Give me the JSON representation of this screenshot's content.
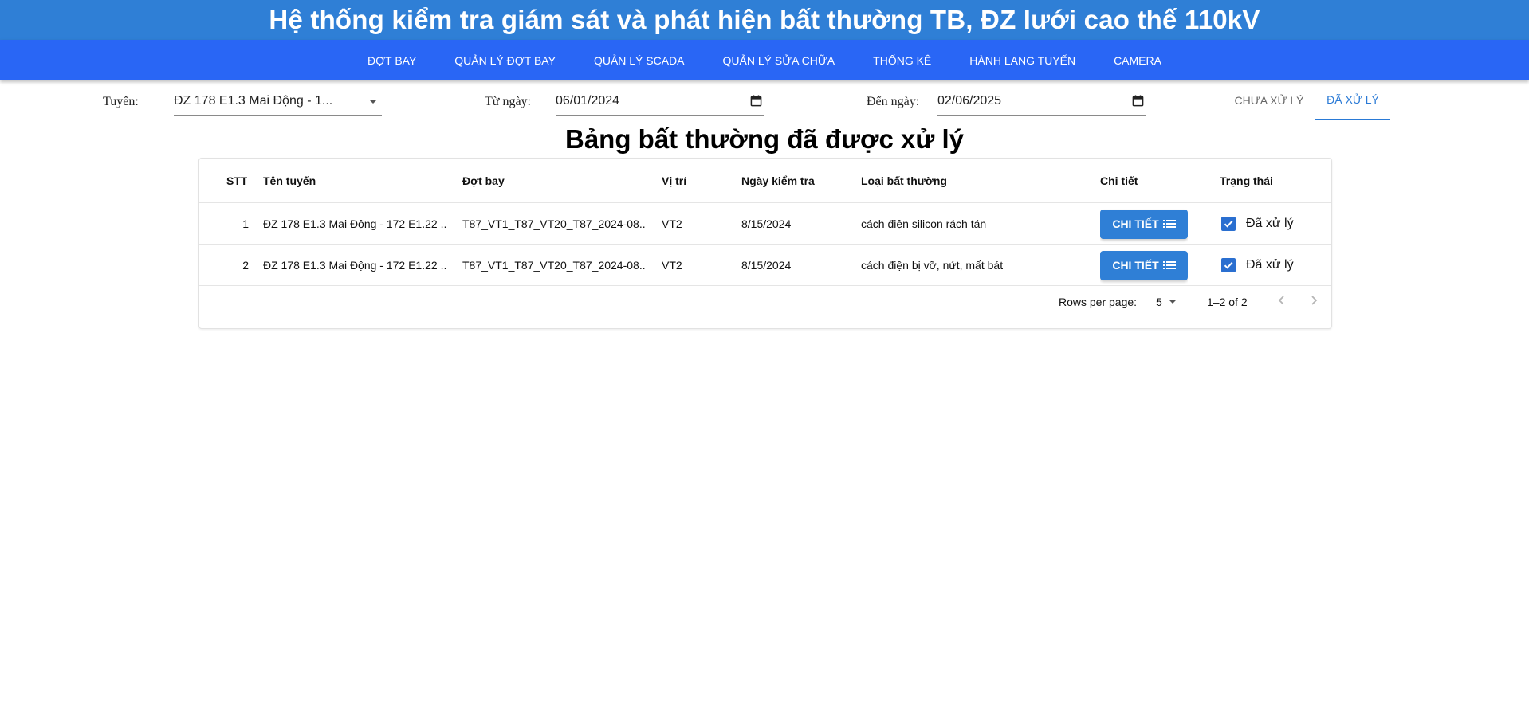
{
  "app": {
    "title": "Hệ thống kiểm tra giám sát và phát hiện bất thường TB, ĐZ lưới cao thế 110kV"
  },
  "nav": {
    "items": [
      {
        "label": "ĐỢT BAY"
      },
      {
        "label": "QUẢN LÝ ĐỢT BAY"
      },
      {
        "label": "QUẢN LÝ SCADA"
      },
      {
        "label": "QUẢN LÝ SỬA CHỮA"
      },
      {
        "label": "THỐNG KÊ"
      },
      {
        "label": "HÀNH LANG TUYẾN"
      },
      {
        "label": "CAMERA"
      }
    ]
  },
  "filters": {
    "line_label": "Tuyến:",
    "line_value": "ĐZ 178 E1.3 Mai Động - 1...",
    "from_label": "Từ ngày:",
    "from_value": "06/01/2024",
    "to_label": "Đến ngày:",
    "to_value": "02/06/2025"
  },
  "tabs": {
    "pending": "CHƯA XỬ LÝ",
    "processed": "ĐÃ XỬ LÝ",
    "active": "processed"
  },
  "table": {
    "heading": "Bảng bất thường đã được xử lý",
    "columns": {
      "stt": "STT",
      "line": "Tên tuyến",
      "flight": "Đợt bay",
      "position": "Vị trí",
      "date": "Ngày kiểm tra",
      "type": "Loại bất thường",
      "detail": "Chi tiết",
      "status": "Trạng thái"
    },
    "rows": [
      {
        "stt": "1",
        "line": "ĐZ 178 E1.3 Mai Động - 172 E1.22 ...",
        "flight": "T87_VT1_T87_VT20_T87_2024-08...",
        "position": "VT2",
        "date": "8/15/2024",
        "type": "cách điện silicon rách tán",
        "detail_button": "CHI TIẾT",
        "status": "Đã xử lý",
        "checked": true
      },
      {
        "stt": "2",
        "line": "ĐZ 178 E1.3 Mai Động - 172 E1.22 ...",
        "flight": "T87_VT1_T87_VT20_T87_2024-08...",
        "position": "VT2",
        "date": "8/15/2024",
        "type": "cách điện bị vỡ, nứt, mất bát",
        "detail_button": "CHI TIẾT",
        "status": "Đã xử lý",
        "checked": true
      }
    ]
  },
  "pagination": {
    "rows_per_page_label": "Rows per page:",
    "rows_per_page_value": "5",
    "range_text": "1–2 of 2"
  },
  "colors": {
    "title_bar": "#2f7fd6",
    "nav_bar": "#2966f5",
    "accent": "#2a7ad6",
    "button": "#2f7fd6"
  }
}
